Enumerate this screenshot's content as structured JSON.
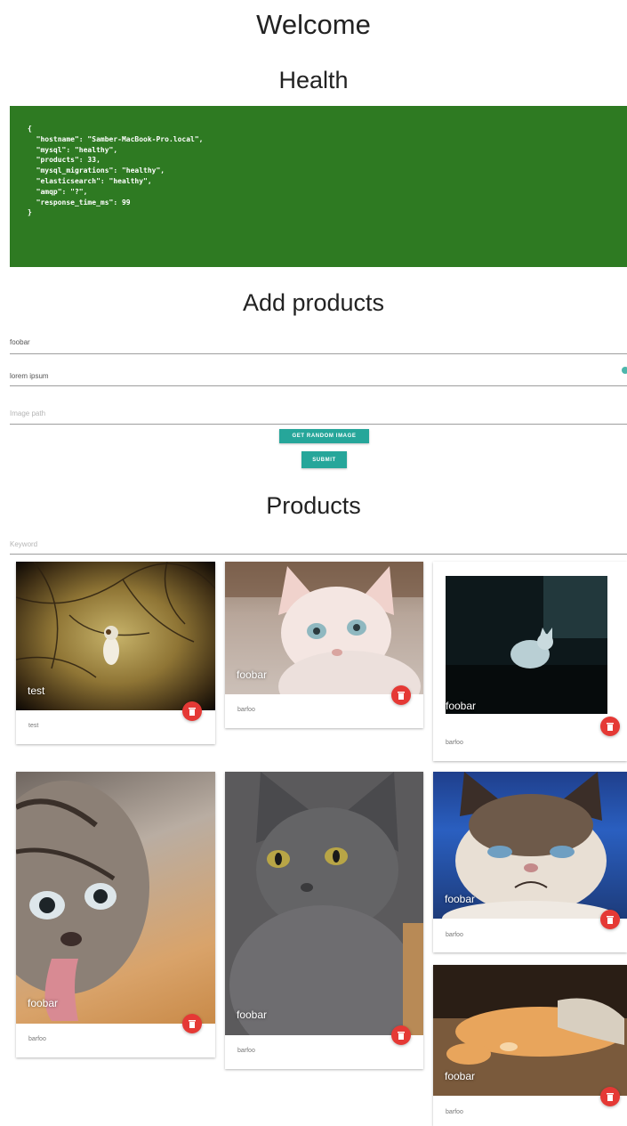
{
  "page": {
    "welcome": "Welcome",
    "health_heading": "Health",
    "add_products_heading": "Add products",
    "products_heading": "Products"
  },
  "health_json_lines": [
    "{",
    "  \"hostname\": \"Samber-MacBook-Pro.local\",",
    "  \"mysql\": \"healthy\",",
    "  \"products\": 33,",
    "  \"mysql_migrations\": \"healthy\",",
    "  \"elasticsearch\": \"healthy\",",
    "  \"amqp\": \"?\",",
    "  \"response_time_ms\": 99",
    "}"
  ],
  "form": {
    "name_value": "foobar",
    "description_value": "lorem ipsum",
    "image_placeholder": "Image path",
    "random_image_label": "Get random image",
    "submit_label": "Submit",
    "accent_color": "#26a69a"
  },
  "search": {
    "placeholder": "Keyword"
  },
  "products": [
    {
      "title": "test",
      "description": "test",
      "icon": "cat-in-tree-photo"
    },
    {
      "title": "foobar",
      "description": "barfoo",
      "icon": "sphynx-cat-photo"
    },
    {
      "title": "foobar",
      "description": "barfoo",
      "icon": "cat-on-counter-photo"
    },
    {
      "title": "foobar",
      "description": "barfoo",
      "icon": "kitten-tongue-photo"
    },
    {
      "title": "foobar",
      "description": "barfoo",
      "icon": "gray-cat-photo"
    },
    {
      "title": "foobar",
      "description": "barfoo",
      "icon": "grumpy-cat-photo"
    },
    {
      "title": "foobar",
      "description": "barfoo",
      "icon": "sleeping-cat-photo"
    }
  ],
  "colors": {
    "health_bg": "#2e7a22",
    "delete_button": "#e53935"
  }
}
